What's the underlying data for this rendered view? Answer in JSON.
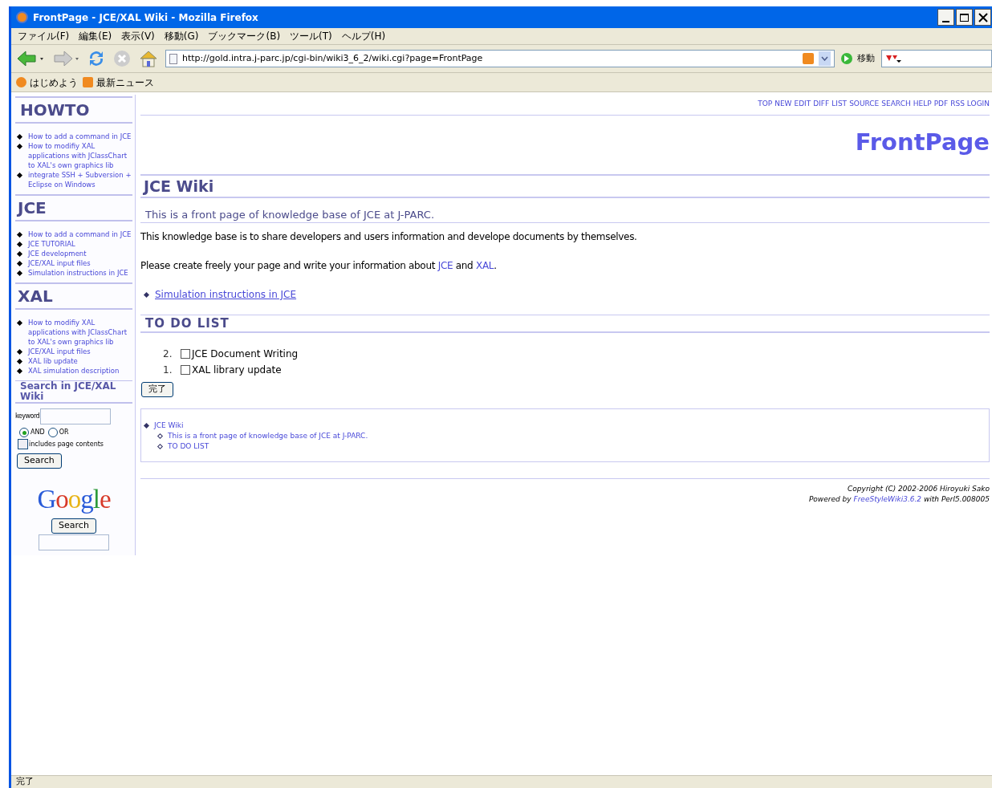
{
  "window": {
    "title": "FrontPage - JCE/XAL Wiki - Mozilla Firefox"
  },
  "menu": [
    "ファイル(F)",
    "編集(E)",
    "表示(V)",
    "移動(G)",
    "ブックマーク(B)",
    "ツール(T)",
    "ヘルプ(H)"
  ],
  "toolbar": {
    "url": "http://gold.intra.j-parc.jp/cgi-bin/wiki3_6_2/wiki.cgi?page=FrontPage",
    "go_label": "移動"
  },
  "bookmarks": [
    "はじめよう",
    "最新ニュース"
  ],
  "sidebar": {
    "sections": [
      {
        "heading": "HOWTO",
        "links": [
          "How to add a command in JCE",
          "How to modifiy XAL applications with JClassChart to XAL's own graphics lib",
          "integrate SSH + Subversion + Eclipse on Windows"
        ]
      },
      {
        "heading": "JCE",
        "links": [
          "How to add a command in JCE",
          "JCE TUTORIAL",
          "JCE development",
          "JCE/XAL input files",
          "Simulation instructions in JCE"
        ]
      },
      {
        "heading": "XAL",
        "links": [
          "How to modifiy XAL applications with JClassChart to XAL's own graphics lib",
          "JCE/XAL input files",
          "XAL lib update",
          "XAL simulation description"
        ]
      }
    ],
    "search": {
      "heading": "Search in JCE/XAL Wiki",
      "keyword_label": "keyword",
      "options": [
        {
          "label": "AND",
          "selected": true
        },
        {
          "label": "OR",
          "selected": false
        }
      ],
      "includes": {
        "label": "includes page contents",
        "checked": false
      },
      "button": "Search"
    },
    "google": {
      "logo": "Google",
      "button": "Search"
    }
  },
  "page": {
    "nav": [
      "TOP",
      "NEW",
      "EDIT",
      "DIFF",
      "LIST",
      "SOURCE",
      "SEARCH",
      "HELP",
      "PDF",
      "RSS",
      "LOGIN"
    ],
    "title": "FrontPage",
    "heading": "JCE Wiki",
    "subheading": "This is a front page of knowledge base of JCE at J-PARC.",
    "paragraphs": [
      [
        {
          "text": "This knowledge base is to share developers and users information and develope documents by themselves.",
          "link": false
        }
      ],
      [
        {
          "text": "Please create freely your page and write your information about ",
          "link": false
        },
        {
          "text": "JCE",
          "link": true
        },
        {
          "text": " and ",
          "link": false
        },
        {
          "text": "XAL",
          "link": true
        },
        {
          "text": ".",
          "link": false
        }
      ]
    ],
    "links": [
      "Simulation instructions in JCE"
    ],
    "todo_heading": "TO DO LIST",
    "todos": [
      {
        "number": "2.",
        "label": "JCE Document Writing",
        "checked": false
      },
      {
        "number": "1.",
        "label": "XAL library update",
        "checked": false
      }
    ],
    "done_button": "完了",
    "toc": [
      {
        "label": "JCE Wiki",
        "children": [
          {
            "label": "This is a front page of knowledge base of JCE at J-PARC."
          },
          {
            "label": "TO DO LIST"
          }
        ]
      }
    ],
    "copyright": "Copyright (C) 2002-2006 Hiroyuki Sako",
    "powered": [
      {
        "text": "Powered by ",
        "link": false
      },
      {
        "text": "FreeStyleWiki3.6.2",
        "link": true
      },
      {
        "text": " with Perl5.008005",
        "link": false
      }
    ]
  },
  "status_bar": "完了"
}
